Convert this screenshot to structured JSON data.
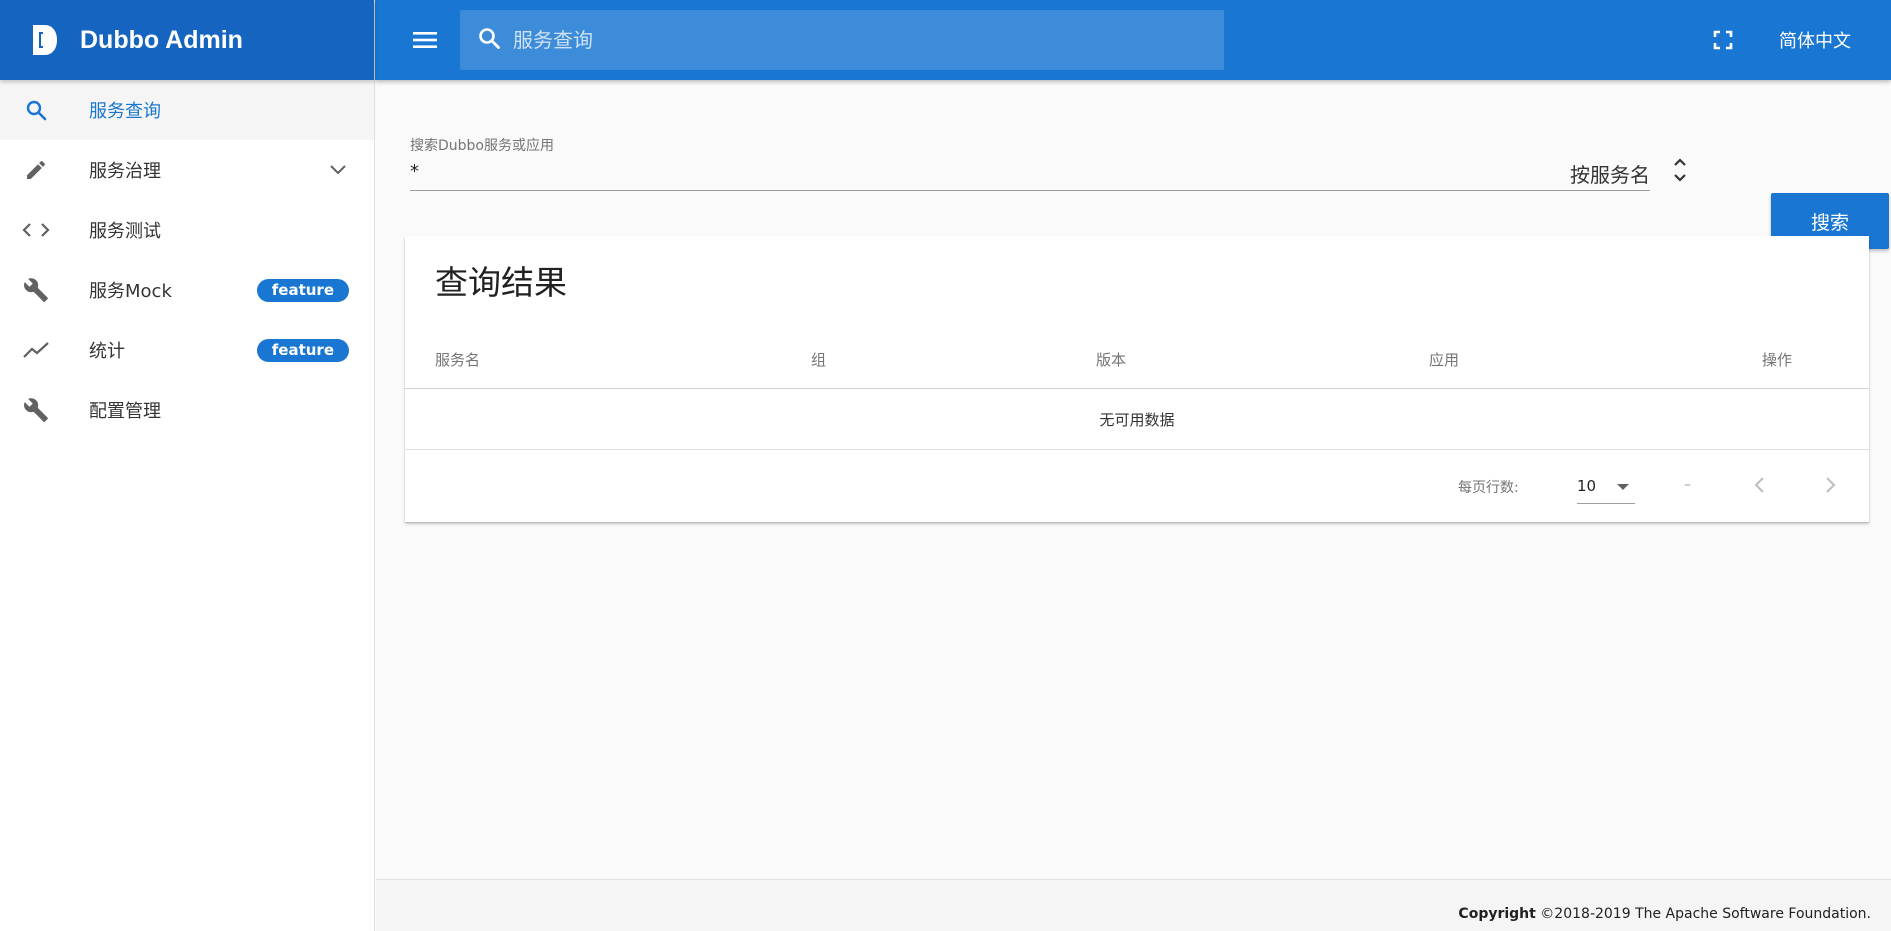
{
  "brand": {
    "title": "Dubbo Admin",
    "color": "#1565c0"
  },
  "topbar": {
    "search_placeholder": "服务查询",
    "language": "简体中文",
    "color": "#1976d2"
  },
  "sidebar": {
    "items": [
      {
        "label": "服务查询",
        "icon": "search-icon",
        "active": true
      },
      {
        "label": "服务治理",
        "icon": "pencil-icon",
        "expandable": true
      },
      {
        "label": "服务测试",
        "icon": "code-icon"
      },
      {
        "label": "服务Mock",
        "icon": "wrench-icon",
        "badge": "feature"
      },
      {
        "label": "统计",
        "icon": "trending-icon",
        "badge": "feature"
      },
      {
        "label": "配置管理",
        "icon": "wrench-icon"
      }
    ]
  },
  "search": {
    "caption": "搜索Dubbo服务或应用",
    "value": "*",
    "type": "按服务名",
    "button_label": "搜索"
  },
  "results": {
    "title": "查询结果",
    "columns": [
      "服务名",
      "组",
      "版本",
      "应用",
      "操作"
    ],
    "empty_text": "无可用数据",
    "rows_per_page_label": "每页行数:",
    "rows_per_page": "10",
    "range_text": "–"
  },
  "footer": {
    "copyright_bold": "Copyright",
    "copyright_text": " ©2018-2019 The Apache Software Foundation."
  }
}
